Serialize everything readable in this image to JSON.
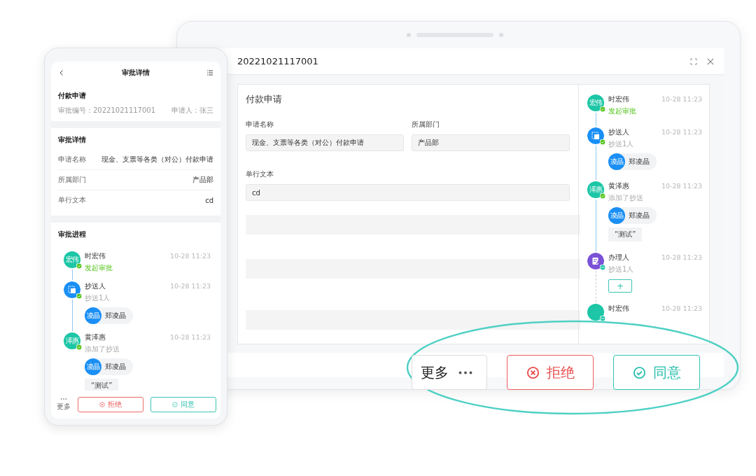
{
  "phone": {
    "title": "审批详情",
    "summary": {
      "title": "付款申请",
      "number": "审批编号：20221021117001",
      "applicant": "申请人：张三"
    },
    "details": {
      "title": "审批详情",
      "rows": [
        {
          "label": "申请名称",
          "value": "现金、支票等各类（对公）付款申请"
        },
        {
          "label": "所属部门",
          "value": "产品部"
        },
        {
          "label": "单行文本",
          "value": "cd"
        }
      ]
    },
    "progress": {
      "title": "审批进程",
      "steps": [
        {
          "kind": "person",
          "avatar": "宏伟",
          "color": "#1cc6a6",
          "done": true,
          "name": "时宏伟",
          "time": "10-28 11:23",
          "note": "发起审批",
          "highlight": true
        },
        {
          "kind": "copy",
          "color": "#1a8ff5",
          "done": true,
          "name": "抄送人",
          "time": "10-28 11:23",
          "note": "抄送1人",
          "highlight": false,
          "chips": [
            {
              "avatar": "凌晶",
              "name": "郑凌晶"
            }
          ]
        },
        {
          "kind": "person",
          "avatar": "泽惠",
          "color": "#1cc6a6",
          "done": true,
          "name": "黄泽惠",
          "time": "10-28 11:23",
          "note": "添加了抄送",
          "highlight": false,
          "chips": [
            {
              "avatar": "凌晶",
              "name": "郑凌晶"
            }
          ],
          "comment": "“测试”"
        }
      ]
    },
    "footer": {
      "more": "更多",
      "reject": "拒绝",
      "approve": "同意"
    }
  },
  "tablet": {
    "title": "20221021117001",
    "form": {
      "title": "付款申请",
      "fields": [
        {
          "label": "申请名称",
          "value": "现金、支票等各类（对公）付款申请",
          "wide": false
        },
        {
          "label": "所属部门",
          "value": "产品部",
          "wide": false
        },
        {
          "label": "单行文本",
          "value": "cd",
          "wide": true
        }
      ]
    },
    "steps": [
      {
        "kind": "person",
        "avatar": "宏伟",
        "color": "#1cc6a6",
        "done": true,
        "name": "时宏伟",
        "time": "10-28 11:23",
        "note": "发起审批",
        "highlight": true
      },
      {
        "kind": "copy",
        "color": "#1a8ff5",
        "done": true,
        "name": "抄送人",
        "time": "10-28 11:23",
        "note": "抄送1人",
        "highlight": false,
        "chips": [
          {
            "avatar": "凌晶",
            "name": "郑凌晶"
          }
        ]
      },
      {
        "kind": "person",
        "avatar": "泽惠",
        "color": "#1cc6a6",
        "done": true,
        "name": "黄泽惠",
        "time": "10-28 11:23",
        "note": "添加了抄送",
        "highlight": false,
        "chips": [
          {
            "avatar": "凌晶",
            "name": "郑凌晶"
          }
        ],
        "comment": "“测试”"
      },
      {
        "kind": "handler",
        "color": "#7b52d6",
        "done": false,
        "name": "办理人",
        "time": "10-28 11:23",
        "note": "抄送1人",
        "highlight": false,
        "add_label": "+"
      },
      {
        "kind": "person",
        "color": "#1cc6a6",
        "done": false,
        "name": "时宏伟",
        "time": "10-28 11:23"
      }
    ]
  },
  "callout": {
    "more": "更多",
    "reject": "拒绝",
    "approve": "同意"
  }
}
